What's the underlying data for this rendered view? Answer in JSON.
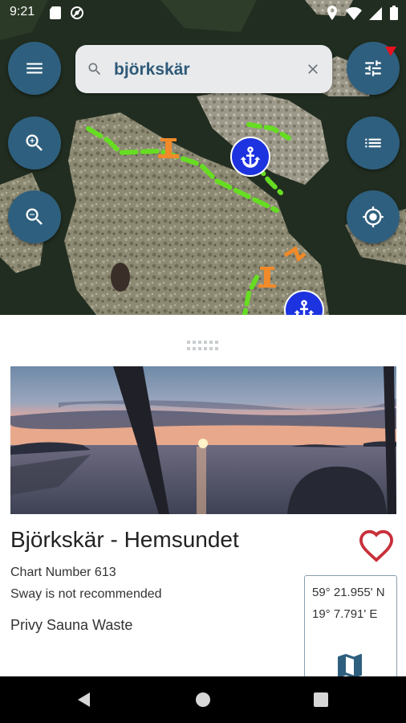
{
  "status_bar": {
    "time": "9:21",
    "left_icons": [
      "sd-card-icon",
      "do-not-disturb-icon"
    ],
    "right_icons": [
      "location-icon",
      "wifi-icon",
      "signal-icon",
      "battery-icon"
    ]
  },
  "map": {
    "search": {
      "value": "björkskär",
      "placeholder": "Search"
    },
    "buttons": [
      "menu-icon",
      "filter-icon",
      "zoom-in-icon",
      "zoom-out-icon",
      "list-icon",
      "my-location-icon"
    ],
    "markers": [
      "anchor-icon",
      "anchor-icon",
      "lighthouse-icon",
      "lighthouse-icon"
    ]
  },
  "place": {
    "name": "Björkskär - Hemsundet",
    "chart_number": "Chart Number 613",
    "sway_note": "Sway is not recommended",
    "facilities": "Privy Sauna Waste",
    "latitude": "59° 21.955' N",
    "longitude": "19° 7.791' E",
    "favorite": false
  },
  "colors": {
    "fab": "#2f5f7e",
    "search_text": "#2f5a78",
    "anchor_marker": "#1d33e0",
    "route": "#66dd22",
    "heart": "#c8303a",
    "filter_badge": "#e8101e"
  }
}
